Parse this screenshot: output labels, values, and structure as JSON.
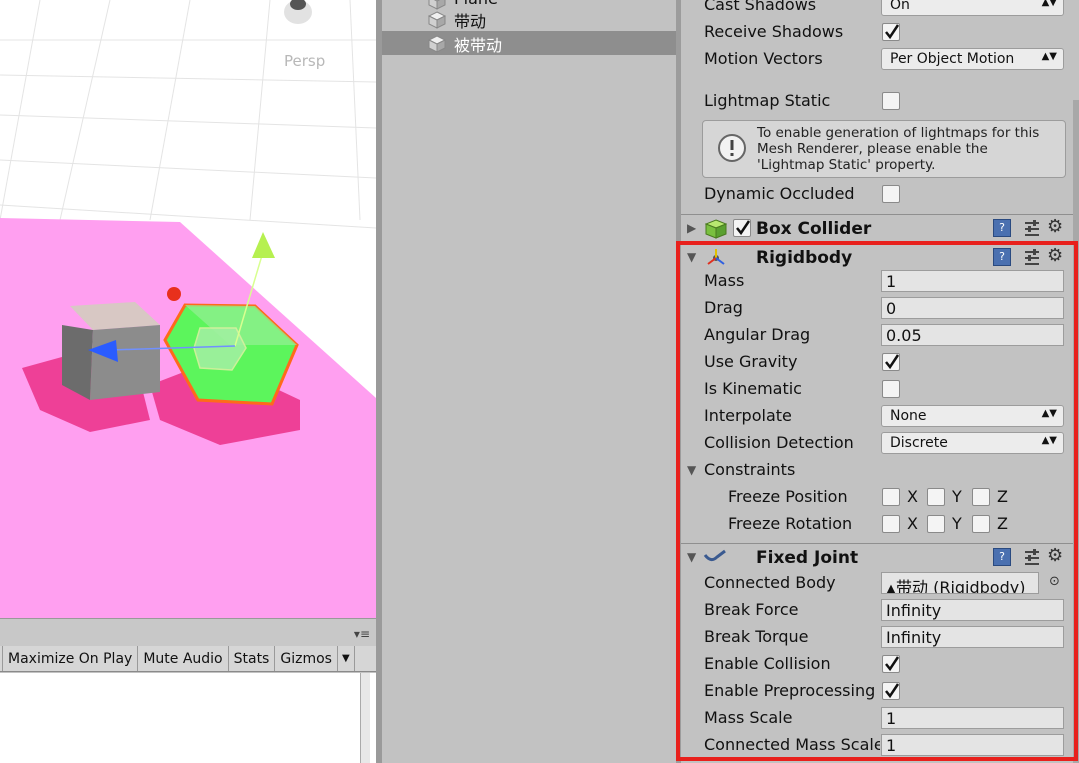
{
  "scene": {
    "persp_label": "Persp"
  },
  "game_toolbar": {
    "maximize_on_play": "Maximize On Play",
    "mute_audio": "Mute Audio",
    "stats": "Stats",
    "gizmos": "Gizmos",
    "menu_icon": "▾≡"
  },
  "hierarchy": {
    "items": [
      {
        "label": "Plane"
      },
      {
        "label": "带动"
      },
      {
        "label": "被带动",
        "selected": true
      }
    ]
  },
  "inspector": {
    "mesh_renderer": {
      "cast_shadows_label": "Cast Shadows",
      "cast_shadows_value": "On",
      "receive_shadows_label": "Receive Shadows",
      "receive_shadows_checked": true,
      "motion_vectors_label": "Motion Vectors",
      "motion_vectors_value": "Per Object Motion",
      "lightmap_static_label": "Lightmap Static",
      "lightmap_static_checked": false,
      "info_text": "To enable generation of lightmaps for this Mesh Renderer, please enable the 'Lightmap Static' property.",
      "dynamic_occluded_label": "Dynamic Occluded",
      "dynamic_occluded_checked": false
    },
    "box_collider": {
      "title": "Box Collider",
      "enabled": true
    },
    "rigidbody": {
      "title": "Rigidbody",
      "mass_label": "Mass",
      "mass": "1",
      "drag_label": "Drag",
      "drag": "0",
      "angular_drag_label": "Angular Drag",
      "angular_drag": "0.05",
      "use_gravity_label": "Use Gravity",
      "use_gravity": true,
      "is_kinematic_label": "Is Kinematic",
      "is_kinematic": false,
      "interpolate_label": "Interpolate",
      "interpolate": "None",
      "collision_detection_label": "Collision Detection",
      "collision_detection": "Discrete",
      "constraints_label": "Constraints",
      "freeze_position_label": "Freeze Position",
      "freeze_rotation_label": "Freeze Rotation",
      "axis_x": "X",
      "axis_y": "Y",
      "axis_z": "Z"
    },
    "fixed_joint": {
      "title": "Fixed Joint",
      "connected_body_label": "Connected Body",
      "connected_body": "带动 (Rigidbody)",
      "break_force_label": "Break Force",
      "break_force": "Infinity",
      "break_torque_label": "Break Torque",
      "break_torque": "Infinity",
      "enable_collision_label": "Enable Collision",
      "enable_collision": true,
      "enable_preprocessing_label": "Enable Preprocessing",
      "enable_preprocessing": true,
      "mass_scale_label": "Mass Scale",
      "mass_scale": "1",
      "connected_mass_scale_label": "Connected Mass Scale",
      "connected_mass_scale": "1"
    }
  },
  "colors": {
    "plane": "#ff9ff0",
    "highlight": "#e8201c",
    "selected_cube": "#5cf55c",
    "grey_cube": "#8c8c8c"
  }
}
